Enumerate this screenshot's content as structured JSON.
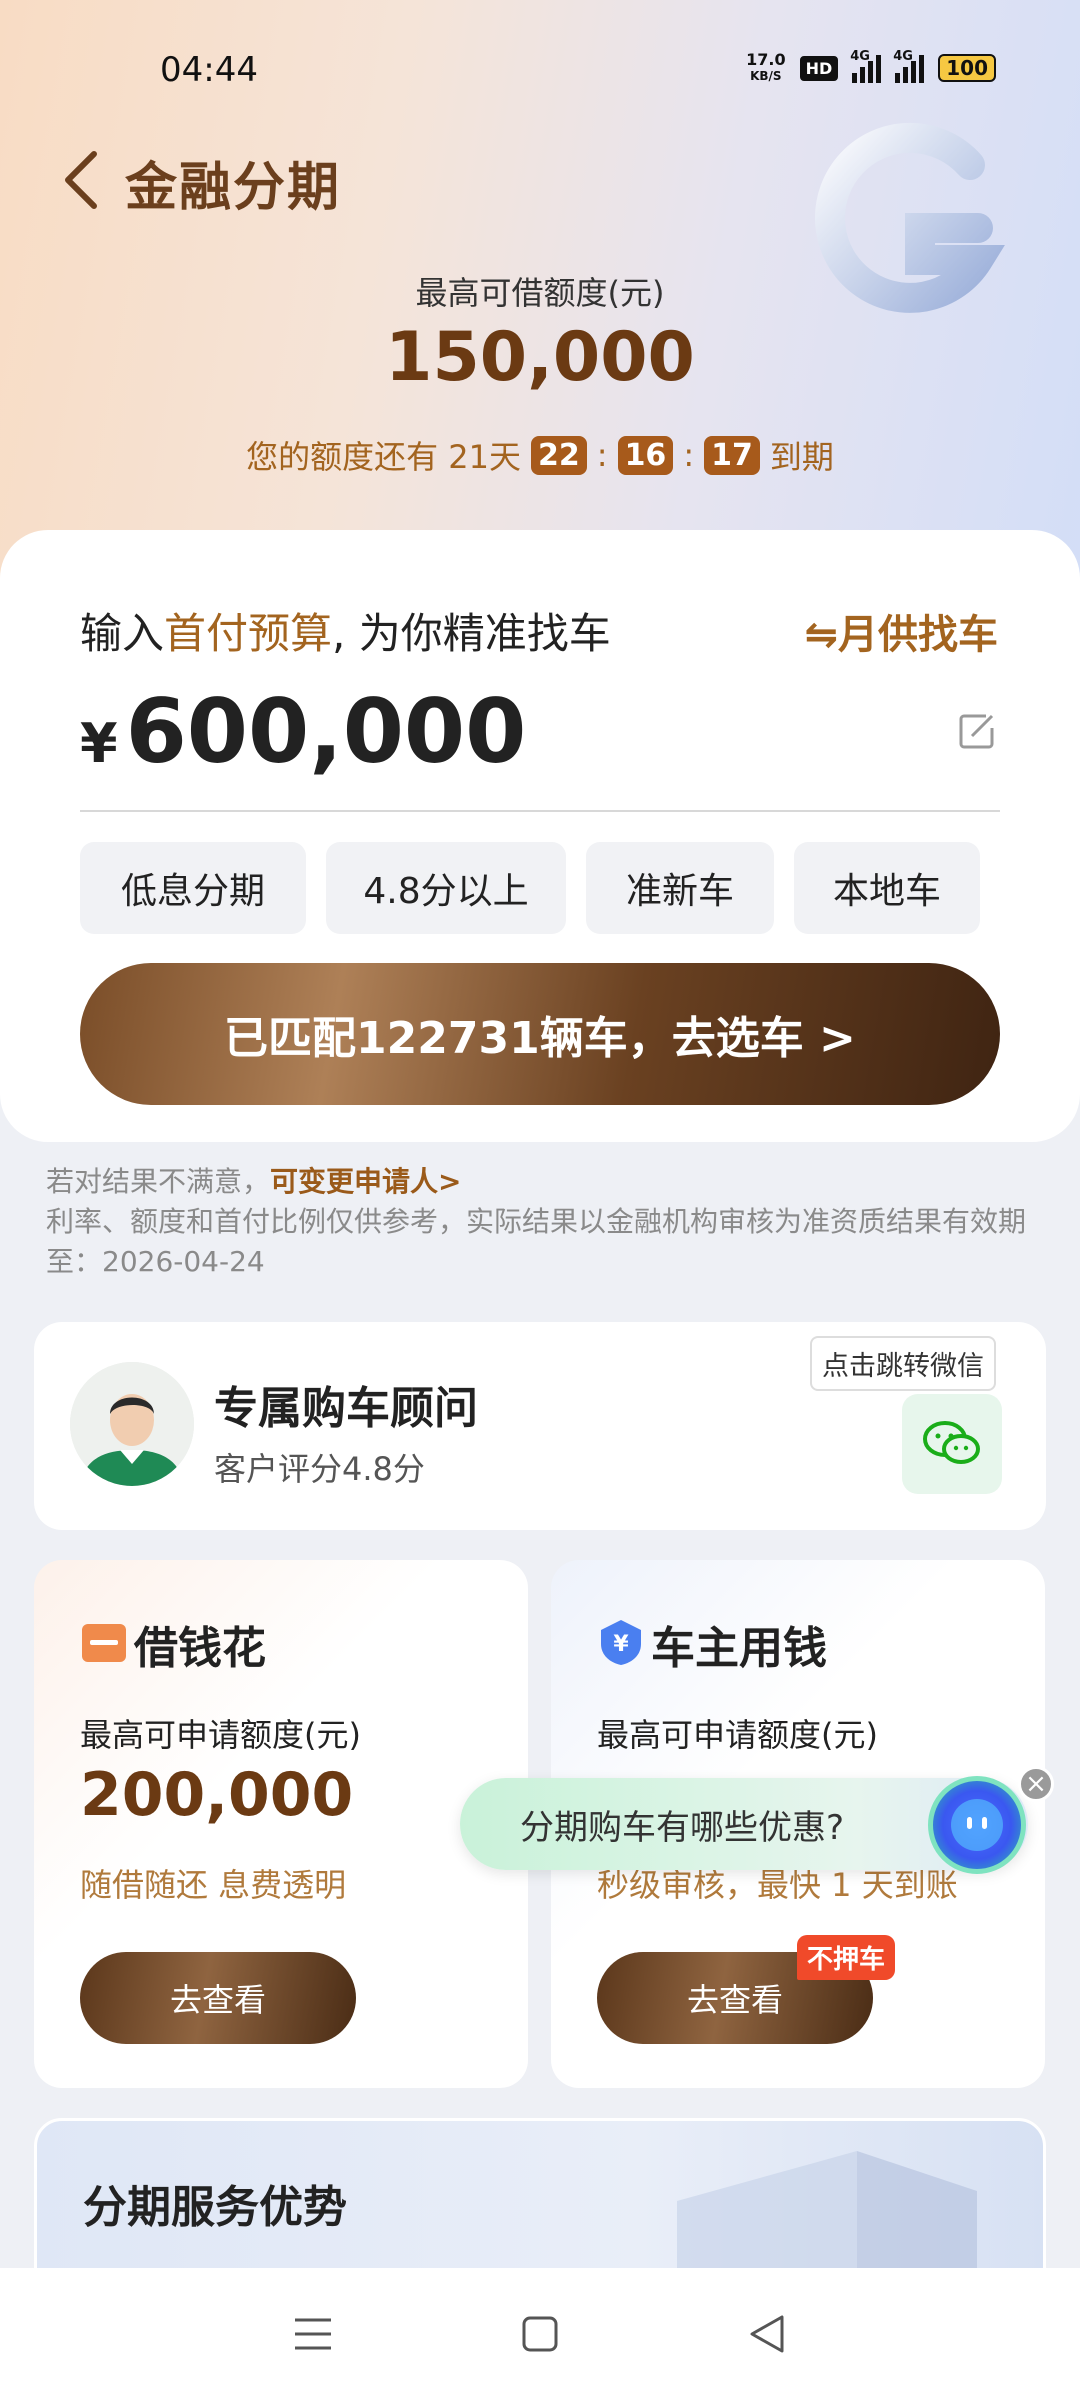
{
  "status_bar": {
    "time": "04:44",
    "net_speed_value": "17.0",
    "net_speed_unit": "KB/S",
    "hd": "HD",
    "sig1": "4G",
    "sig2": "4G",
    "battery": "100"
  },
  "header": {
    "title": "金融分期"
  },
  "credit": {
    "label": "最高可借额度(元)",
    "amount": "150,000",
    "countdown_prefix": "您的额度还有 21天",
    "hours": "22",
    "minutes": "16",
    "seconds": "17",
    "sep": ":",
    "countdown_suffix": "到期"
  },
  "budget": {
    "title_prefix": "输入",
    "title_highlight": "首付预算",
    "title_suffix": ", 为你精准找车",
    "monthly_link": "⇋月供找车",
    "currency": "¥",
    "price": "600,000",
    "tags": [
      "低息分期",
      "4.8分以上",
      "准新车",
      "本地车"
    ],
    "cta": "已匹配122731辆车，去选车 >"
  },
  "notice": {
    "line1_prefix": "若对结果不满意，",
    "line1_link": "可变更申请人>",
    "line2": "利率、额度和首付比例仅供参考，实际结果以金融机构审核为准资质结果有效期至：2026-04-24"
  },
  "advisor": {
    "name": "专属购车顾问",
    "rating": "客户评分4.8分",
    "wechat_tip": "点击跳转微信"
  },
  "loans": {
    "left": {
      "title": "借钱花",
      "label": "最高可申请额度(元)",
      "amount": "200,000",
      "desc": "随借随还 息费透明",
      "button": "去查看"
    },
    "right": {
      "title": "车主用钱",
      "label": "最高可申请额度(元)",
      "desc": "秒级审核，最快 1 天到账",
      "button": "去查看",
      "badge": "不押车"
    }
  },
  "faq": {
    "text": "分期购车有哪些优惠?",
    "close": "×"
  },
  "advantage": {
    "title": "分期服务优势"
  },
  "colors": {
    "accent_brown": "#6b3a13",
    "accent_orange": "#a3641f",
    "badge_red": "#f04a2a"
  }
}
